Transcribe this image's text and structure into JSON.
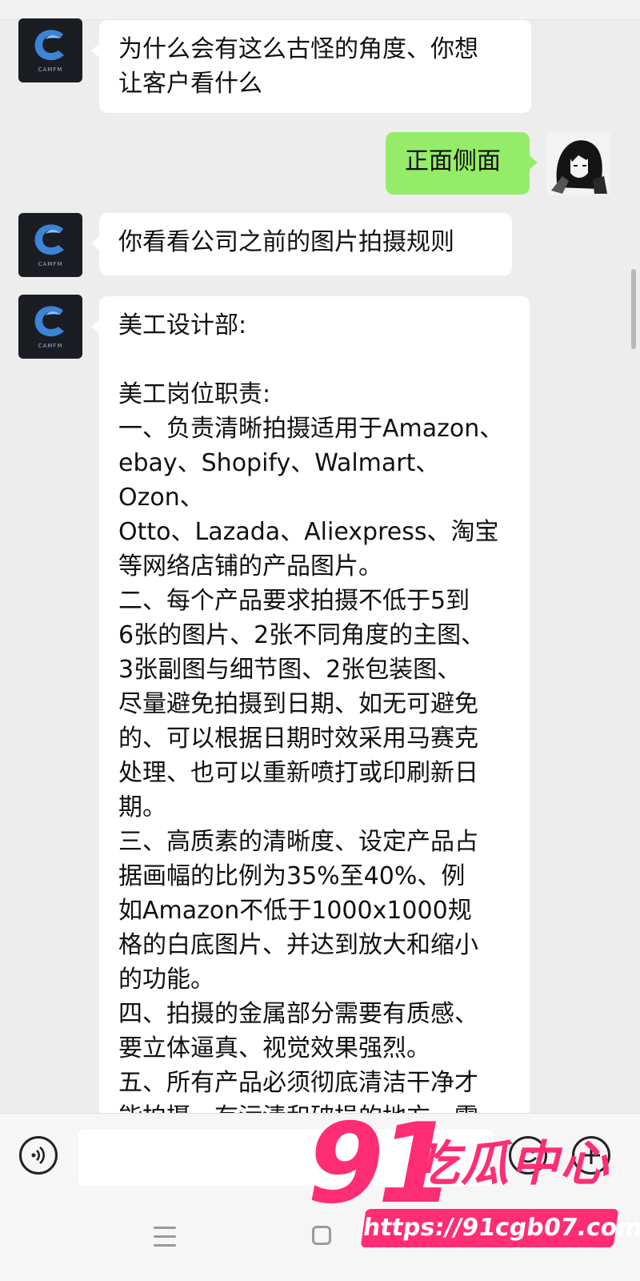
{
  "messages": [
    {
      "side": "left",
      "sender_avatar_text": "CAMFM",
      "text": "为什么会有这么古怪的角度、你想\n让客户看什么"
    },
    {
      "side": "right",
      "text": "正面侧面"
    },
    {
      "side": "left",
      "sender_avatar_text": "CAMFM",
      "text": "你看看公司之前的图片拍摄规则"
    },
    {
      "side": "left",
      "sender_avatar_text": "CAMFM",
      "text": "美工设计部:\n\n美工岗位职责:\n一、负责清晰拍摄适用于Amazon、\nebay、Shopify、Walmart、Ozon、\nOtto、Lazada、Aliexpress、淘宝\n等网络店铺的产品图片。\n二、每个产品要求拍摄不低于5到\n6张的图片、2张不同角度的主图、\n3张副图与细节图、2张包装图、\n尽量避免拍摄到日期、如无可避免\n的、可以根据日期时效采用马赛克\n处理、也可以重新喷打或印刷新日\n期。\n三、高质素的清晰度、设定产品占\n据画幅的比例为35%至40%、例\n如Amazon不低于1000x1000规\n格的白底图片、并达到放大和缩小\n的功能。\n四、拍摄的金属部分需要有质感、\n要立体逼真、视觉效果强烈。\n五、所有产品必须彻底清洁干净才\n能拍摄、有污渍和破损的地方、需"
    }
  ],
  "input_bar": {
    "voice_icon": "voice-icon",
    "emoji_icon": "emoji-icon",
    "plus_icon": "plus-icon"
  },
  "watermark": {
    "big_number": "91",
    "chinese": "吃瓜中心",
    "url": "https://91cgb07.com"
  },
  "colors": {
    "background": "#ededed",
    "bubble_self": "#95ec69",
    "bubble_other": "#ffffff",
    "watermark": "#ff2d74"
  }
}
